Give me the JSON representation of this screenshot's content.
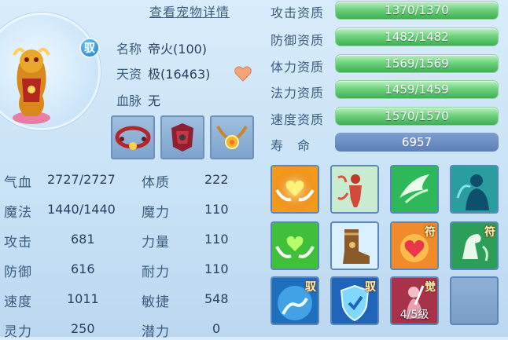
{
  "header": {
    "detail_link": "查看宠物详情"
  },
  "pet": {
    "bind_badge": "驭",
    "name_label": "名称",
    "name_value": "帝火(100)",
    "grade_label": "天资",
    "grade_value": "极(16463)",
    "bloodline_label": "血脉",
    "bloodline_value": "无"
  },
  "stats": [
    {
      "label": "气血",
      "value": "2727/2727"
    },
    {
      "label": "体质",
      "value": "222"
    },
    {
      "label": "魔法",
      "value": "1440/1440"
    },
    {
      "label": "魔力",
      "value": "110"
    },
    {
      "label": "攻击",
      "value": "681"
    },
    {
      "label": "力量",
      "value": "110"
    },
    {
      "label": "防御",
      "value": "616"
    },
    {
      "label": "耐力",
      "value": "110"
    },
    {
      "label": "速度",
      "value": "1011"
    },
    {
      "label": "敏捷",
      "value": "548"
    },
    {
      "label": "灵力",
      "value": "250"
    },
    {
      "label": "潜力",
      "value": "0"
    }
  ],
  "aptitudes": [
    {
      "label": "攻击资质",
      "value": "1370/1370",
      "fill": 1.0
    },
    {
      "label": "防御资质",
      "value": "1482/1482",
      "fill": 1.0
    },
    {
      "label": "体力资质",
      "value": "1569/1569",
      "fill": 1.0
    },
    {
      "label": "法力资质",
      "value": "1459/1459",
      "fill": 1.0
    },
    {
      "label": "速度资质",
      "value": "1570/1570",
      "fill": 1.0
    }
  ],
  "lifespan": {
    "label": "寿　命",
    "value": "6957"
  },
  "skills": {
    "tags": {
      "bind": "驭",
      "talisman": "符",
      "awaken": "觉"
    },
    "awaken_grade": "4/5级"
  },
  "colors": {
    "bar_green": "#4fbe62",
    "life_bar": "#6b8cc4",
    "text": "#3c5c80"
  }
}
